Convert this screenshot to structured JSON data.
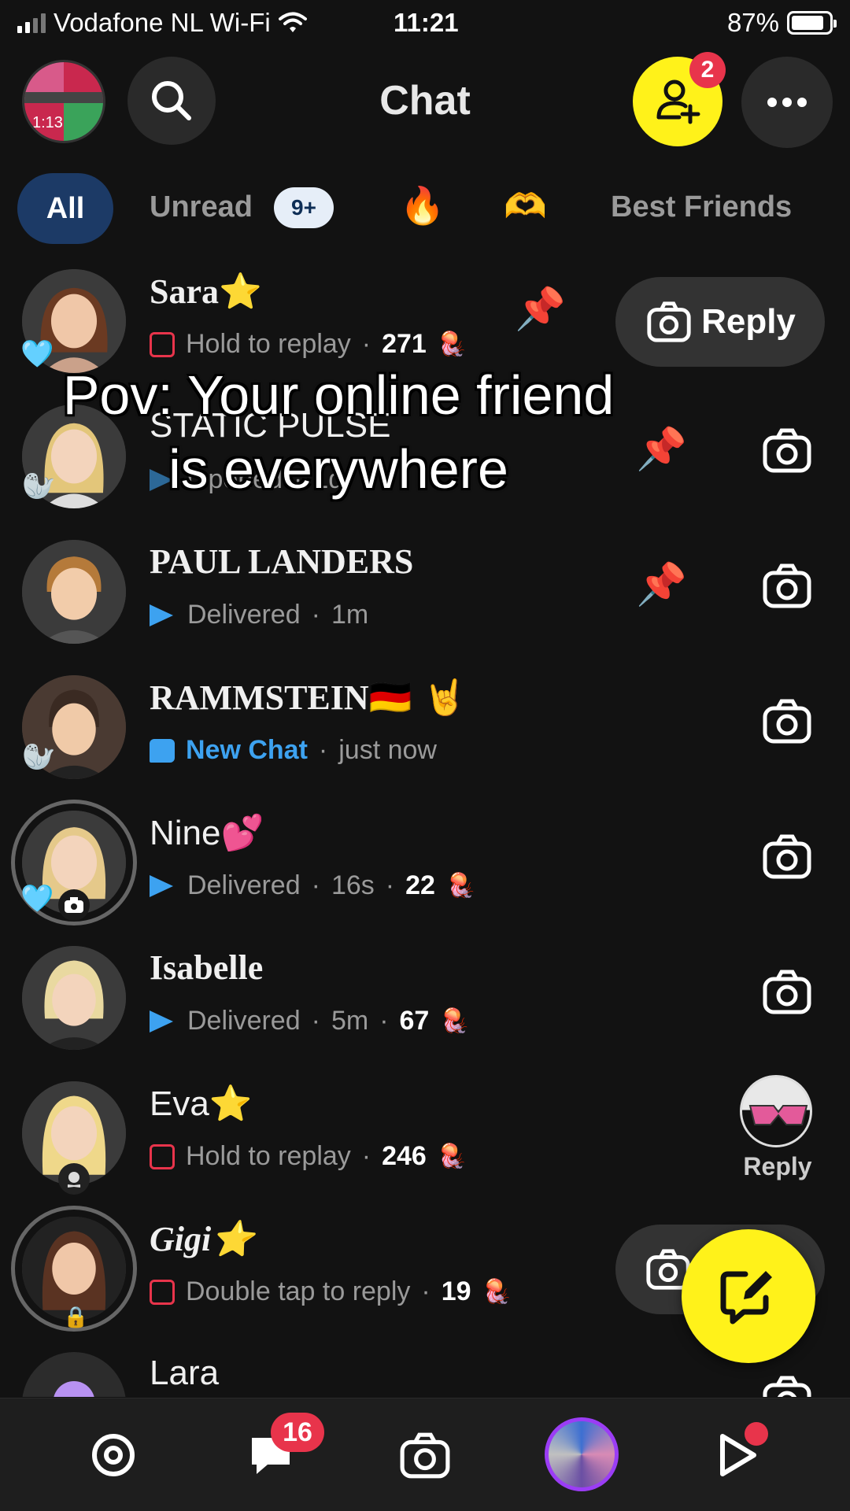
{
  "status_bar": {
    "carrier": "Vodafone NL Wi-Fi",
    "time": "11:21",
    "battery": "87%",
    "battery_level": 0.87
  },
  "header": {
    "title": "Chat",
    "add_friends_badge": "2",
    "avatar_time": "1:13"
  },
  "filters": {
    "all": "All",
    "unread": "Unread",
    "unread_count": "9+",
    "fire": "🔥",
    "hands": "🫶",
    "best_friends": "Best Friends"
  },
  "caption": {
    "line1": "Pov: Your online friend",
    "line2": "is everywhere"
  },
  "chats": [
    {
      "name": "Sara",
      "emoji": "⭐",
      "status": "Hold to replay",
      "dot": "·",
      "streak": "271",
      "streak_icon": "🪼",
      "badge": "🩵",
      "action": "Reply",
      "pinned": true
    },
    {
      "name": "STATIC PULSE",
      "emoji": "",
      "status": "Opened",
      "dot": "·",
      "time": "1d",
      "badge": "🦭",
      "pinned": true
    },
    {
      "name": "PAUL LANDERS",
      "emoji": "",
      "status": "Delivered",
      "dot": "·",
      "time": "1m",
      "pinned": true
    },
    {
      "name": "RAMMSTEIN",
      "emoji": "🇩🇪 🤘",
      "status": "New Chat",
      "dot": "·",
      "time": "just now",
      "badge": "🦭"
    },
    {
      "name": "Nine",
      "emoji": "💕",
      "status": "Delivered",
      "dot": "·",
      "time": "16s",
      "dot2": "·",
      "streak": "22",
      "streak_icon": "🪼",
      "badge": "🩵"
    },
    {
      "name": "Isabelle",
      "emoji": "",
      "status": "Delivered",
      "dot": "·",
      "time": "5m",
      "dot2": "·",
      "streak": "67",
      "streak_icon": "🪼"
    },
    {
      "name": "Eva",
      "emoji": "⭐",
      "status": "Hold to replay",
      "dot": "·",
      "streak": "246",
      "streak_icon": "🪼",
      "action": "Reply"
    },
    {
      "name": "Gigi",
      "emoji": "⭐",
      "status": "Double tap to reply",
      "dot": "·",
      "streak": "19",
      "streak_icon": "🪼"
    },
    {
      "name": "Lara"
    }
  ],
  "bottom_nav": {
    "chat_badge": "16",
    "items": [
      "map-icon",
      "chat-icon",
      "camera-icon",
      "stories-avatar",
      "spotlight-icon"
    ]
  },
  "colors": {
    "background": "#121212",
    "accent_yellow": "#fff21a",
    "badge_red": "#e8344b",
    "delivered_blue": "#3da2f0",
    "all_chip": "#1c3a66"
  }
}
